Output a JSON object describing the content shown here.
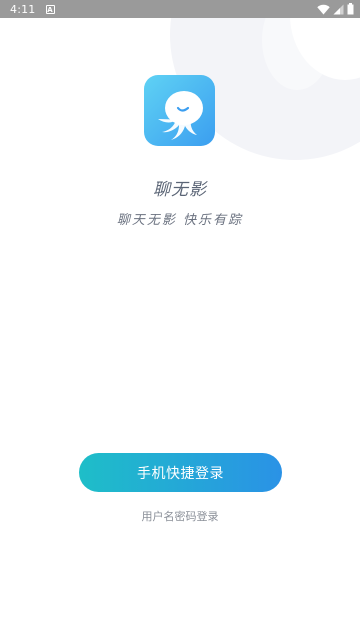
{
  "status_bar": {
    "time": "4:11",
    "notification_glyph": "A",
    "icons": [
      "wifi-icon",
      "signal-icon",
      "battery-icon"
    ]
  },
  "app": {
    "name": "聊无影",
    "slogan": "聊天无影 快乐有踪"
  },
  "actions": {
    "phone_login_label": "手机快捷登录",
    "username_login_label": "用户名密码登录"
  },
  "colors": {
    "status_bar": "#9a9a9a",
    "logo_gradient_start": "#5fd2f4",
    "logo_gradient_end": "#3b9ef0",
    "button_gradient_start": "#1ebec8",
    "button_gradient_end": "#2a92e6",
    "app_name": "#5a6475",
    "secondary_text": "#8a8f98"
  }
}
